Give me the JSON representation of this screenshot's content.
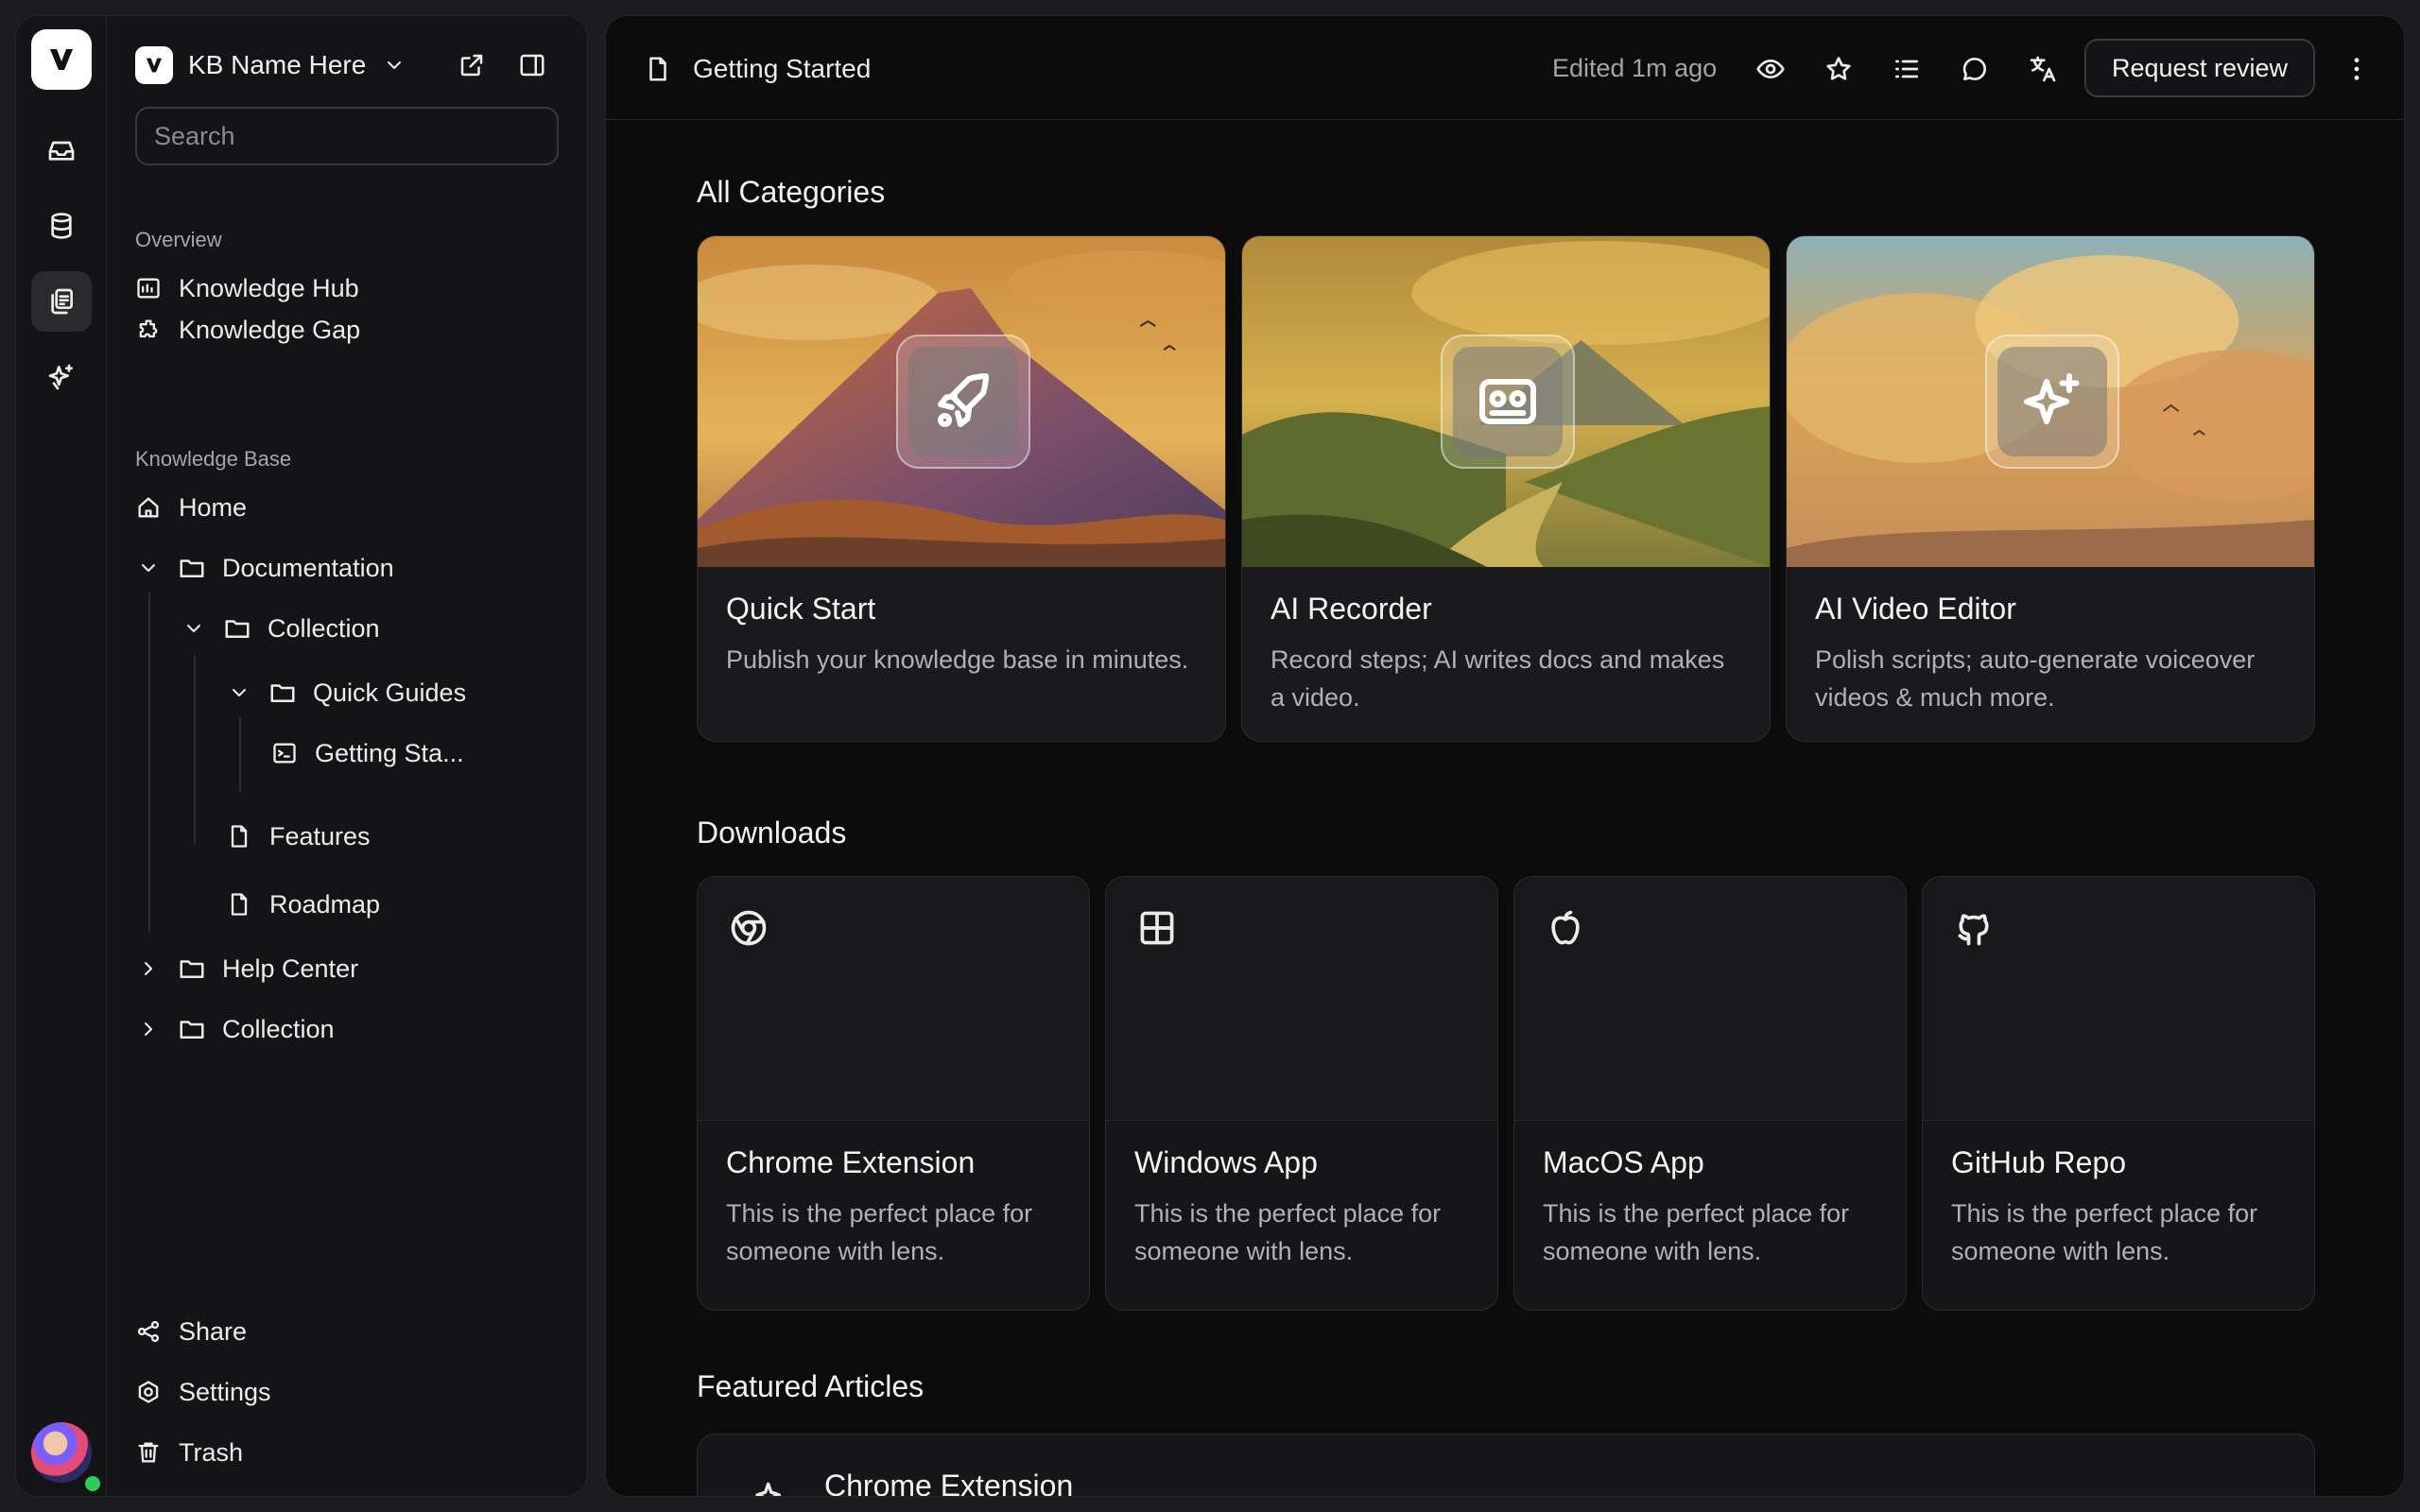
{
  "workspace": {
    "name": "KB Name Here"
  },
  "search": {
    "placeholder": "Search"
  },
  "sidebar": {
    "overview_label": "Overview",
    "overview_items": [
      "Knowledge Hub",
      "Knowledge Gap"
    ],
    "kb_label": "Knowledge Base",
    "tree": {
      "home": "Home",
      "documentation": "Documentation",
      "collection": "Collection",
      "quick_guides": "Quick Guides",
      "getting_started": "Getting Sta...",
      "features": "Features",
      "roadmap": "Roadmap",
      "help_center": "Help Center",
      "collection2": "Collection"
    },
    "footer": {
      "share": "Share",
      "settings": "Settings",
      "trash": "Trash"
    }
  },
  "header": {
    "doc_title": "Getting Started",
    "edited": "Edited 1m ago",
    "review_button": "Request review"
  },
  "sections": {
    "categories": "All Categories",
    "downloads": "Downloads",
    "featured": "Featured Articles"
  },
  "categories": [
    {
      "title": "Quick Start",
      "desc": "Publish your knowledge base in minutes.",
      "icon": "rocket-icon"
    },
    {
      "title": "AI Recorder",
      "desc": "Record steps; AI writes docs and makes a video.",
      "icon": "recorder-icon"
    },
    {
      "title": "AI Video Editor",
      "desc": "Polish scripts; auto-generate voiceover videos & much more.",
      "icon": "sparkles-icon"
    }
  ],
  "downloads": [
    {
      "title": "Chrome Extension",
      "desc": "This is the perfect place for someone with lens.",
      "icon": "chrome-icon"
    },
    {
      "title": "Windows App",
      "desc": "This is the perfect place for someone with lens.",
      "icon": "windows-icon"
    },
    {
      "title": "MacOS App",
      "desc": "This is the perfect place for someone with lens.",
      "icon": "apple-icon"
    },
    {
      "title": "GitHub Repo",
      "desc": "This is the perfect place for someone with lens.",
      "icon": "github-icon"
    }
  ],
  "featured": [
    {
      "title": "Chrome Extension"
    }
  ],
  "colors": {
    "background": "#0c0c0d",
    "panel": "#141416",
    "online": "#2ecc5a"
  }
}
